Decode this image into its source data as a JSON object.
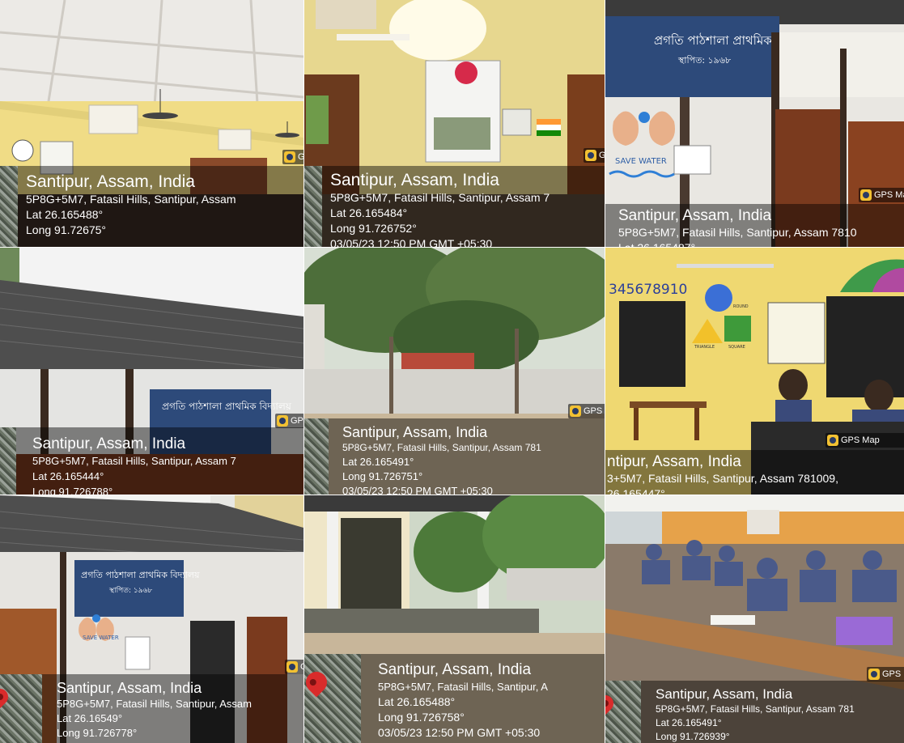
{
  "gps_badge_label": "GPS Map",
  "photos": [
    {
      "name": "classroom-ceiling",
      "place": "Santipur, Assam, India",
      "address": "5P8G+5M7, Fatasil Hills, Santipur, Assam",
      "lat": "Lat 26.165488°",
      "long": "Long 91.72675°",
      "datetime": ""
    },
    {
      "name": "wall-poster-flag",
      "place": "Santipur, Assam, India",
      "address": "5P8G+5M7, Fatasil Hills, Santipur, Assam 7",
      "lat": "Lat 26.165484°",
      "long": "Long 91.726752°",
      "datetime": "03/05/23 12:50 PM GMT +05:30"
    },
    {
      "name": "school-signboard",
      "place": "Santipur, Assam, India",
      "address": "5P8G+5M7, Fatasil Hills, Santipur, Assam 7810",
      "lat": "Lat 26.165487°",
      "long": "",
      "datetime": ""
    },
    {
      "name": "school-roof",
      "place": "Santipur, Assam, India",
      "address": "5P8G+5M7, Fatasil Hills, Santipur, Assam 7",
      "lat": "Lat 26.165444°",
      "long": "Long 91.726788°",
      "datetime": ""
    },
    {
      "name": "school-yard-trees",
      "place": "Santipur, Assam, India",
      "address": "5P8G+5M7, Fatasil Hills, Santipur, Assam 781",
      "lat": "Lat 26.165491°",
      "long": "Long 91.726751°",
      "datetime": "03/05/23 12:50 PM GMT +05:30"
    },
    {
      "name": "classroom-wall-shapes",
      "place": "ntipur, Assam, India",
      "address": "3+5M7, Fatasil Hills, Santipur, Assam 781009,",
      "lat": "26.165447°",
      "long": "",
      "datetime": ""
    },
    {
      "name": "school-building-front",
      "place": "Santipur, Assam, India",
      "address": "5P8G+5M7, Fatasil Hills, Santipur, Assam",
      "lat": "Lat 26.16549°",
      "long": "Long 91.726778°",
      "datetime": ""
    },
    {
      "name": "school-veranda",
      "place": "Santipur, Assam, India",
      "address": "5P8G+5M7, Fatasil Hills, Santipur, A",
      "lat": "Lat 26.165488°",
      "long": "Long 91.726758°",
      "datetime": "03/05/23 12:50 PM GMT +05:30"
    },
    {
      "name": "students-at-desks",
      "place": "Santipur, Assam, India",
      "address": "5P8G+5M7, Fatasil Hills, Santipur, Assam 781",
      "lat": "Lat 26.165491°",
      "long": "Long 91.726939°",
      "datetime": ""
    }
  ],
  "scene_text": {
    "save_water": "SAVE WATER",
    "numbers_strip": "345678910",
    "bengali_sign": "প্ৰগতি পাঠশালা প্ৰাথমিক বিদ্যালয়",
    "bengali_year": "স্থাপিত: ১৯৬৮",
    "shape_round": "ROUND",
    "shape_triangle": "TRIANGLE",
    "shape_square": "SQUARE"
  }
}
